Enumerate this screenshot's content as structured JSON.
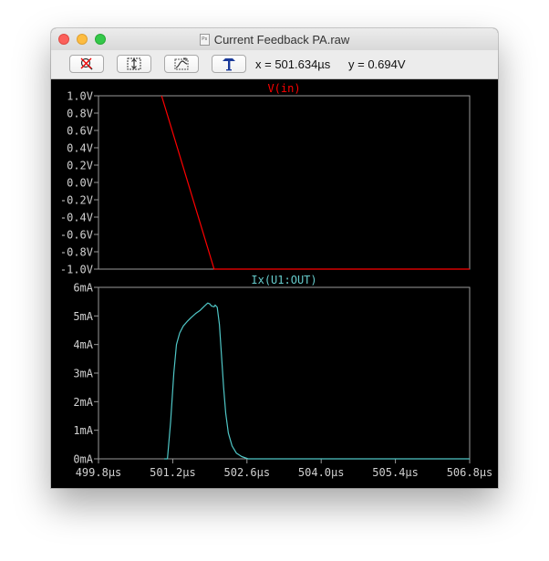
{
  "window": {
    "title": "Current Feedback PA.raw",
    "file_icon_label": "Ps"
  },
  "toolbar": {
    "buttons": [
      {
        "name": "autorange-button",
        "icon": "magnifier-cross-icon"
      },
      {
        "name": "fit-vertical-button",
        "icon": "fit-vertical-icon"
      },
      {
        "name": "curve-select-button",
        "icon": "curve-select-icon"
      },
      {
        "name": "probe-button",
        "icon": "probe-icon"
      }
    ],
    "x_readout": "x = 501.634µs",
    "y_readout": "y = 0.694V"
  },
  "chart_data": [
    {
      "type": "line",
      "title": "V(in)",
      "title_color": "#ff0000",
      "ylim": [
        -1.0,
        1.0
      ],
      "y_ticks": [
        "1.0V",
        "0.8V",
        "0.6V",
        "0.4V",
        "0.2V",
        "0.0V",
        "-0.2V",
        "-0.4V",
        "-0.6V",
        "-0.8V",
        "-1.0V"
      ],
      "xlim": [
        499.8,
        506.8
      ],
      "series": [
        {
          "color": "#ff0000",
          "x": [
            500.99,
            501.98,
            506.8
          ],
          "y": [
            1.0,
            -1.0,
            -1.0
          ]
        }
      ]
    },
    {
      "type": "line",
      "title": "Ix(U1:OUT)",
      "title_color": "#66cccc",
      "ylim": [
        0,
        6
      ],
      "y_ticks": [
        "6mA",
        "5mA",
        "4mA",
        "3mA",
        "2mA",
        "1mA",
        "0mA"
      ],
      "xlim": [
        499.8,
        506.8
      ],
      "x_ticks": [
        "499.8µs",
        "501.2µs",
        "502.6µs",
        "504.0µs",
        "505.4µs",
        "506.8µs"
      ],
      "series": [
        {
          "color": "#4fc6c6",
          "x": [
            500.0,
            501.04,
            501.1,
            501.16,
            501.22,
            501.27,
            501.33,
            501.4,
            501.47,
            501.55,
            501.63,
            501.72,
            501.8,
            501.86,
            501.9,
            501.93,
            501.98,
            502.0,
            502.04,
            502.08,
            502.12,
            502.16,
            502.2,
            502.25,
            502.32,
            502.4,
            502.5,
            502.62,
            506.8
          ],
          "y": [
            null,
            0.0,
            0.0,
            1.3,
            3.0,
            4.0,
            4.4,
            4.65,
            4.8,
            4.95,
            5.08,
            5.2,
            5.35,
            5.45,
            5.42,
            5.35,
            5.32,
            5.38,
            5.3,
            4.7,
            3.6,
            2.5,
            1.6,
            0.9,
            0.45,
            0.2,
            0.08,
            0.0,
            0.0
          ]
        }
      ]
    }
  ]
}
